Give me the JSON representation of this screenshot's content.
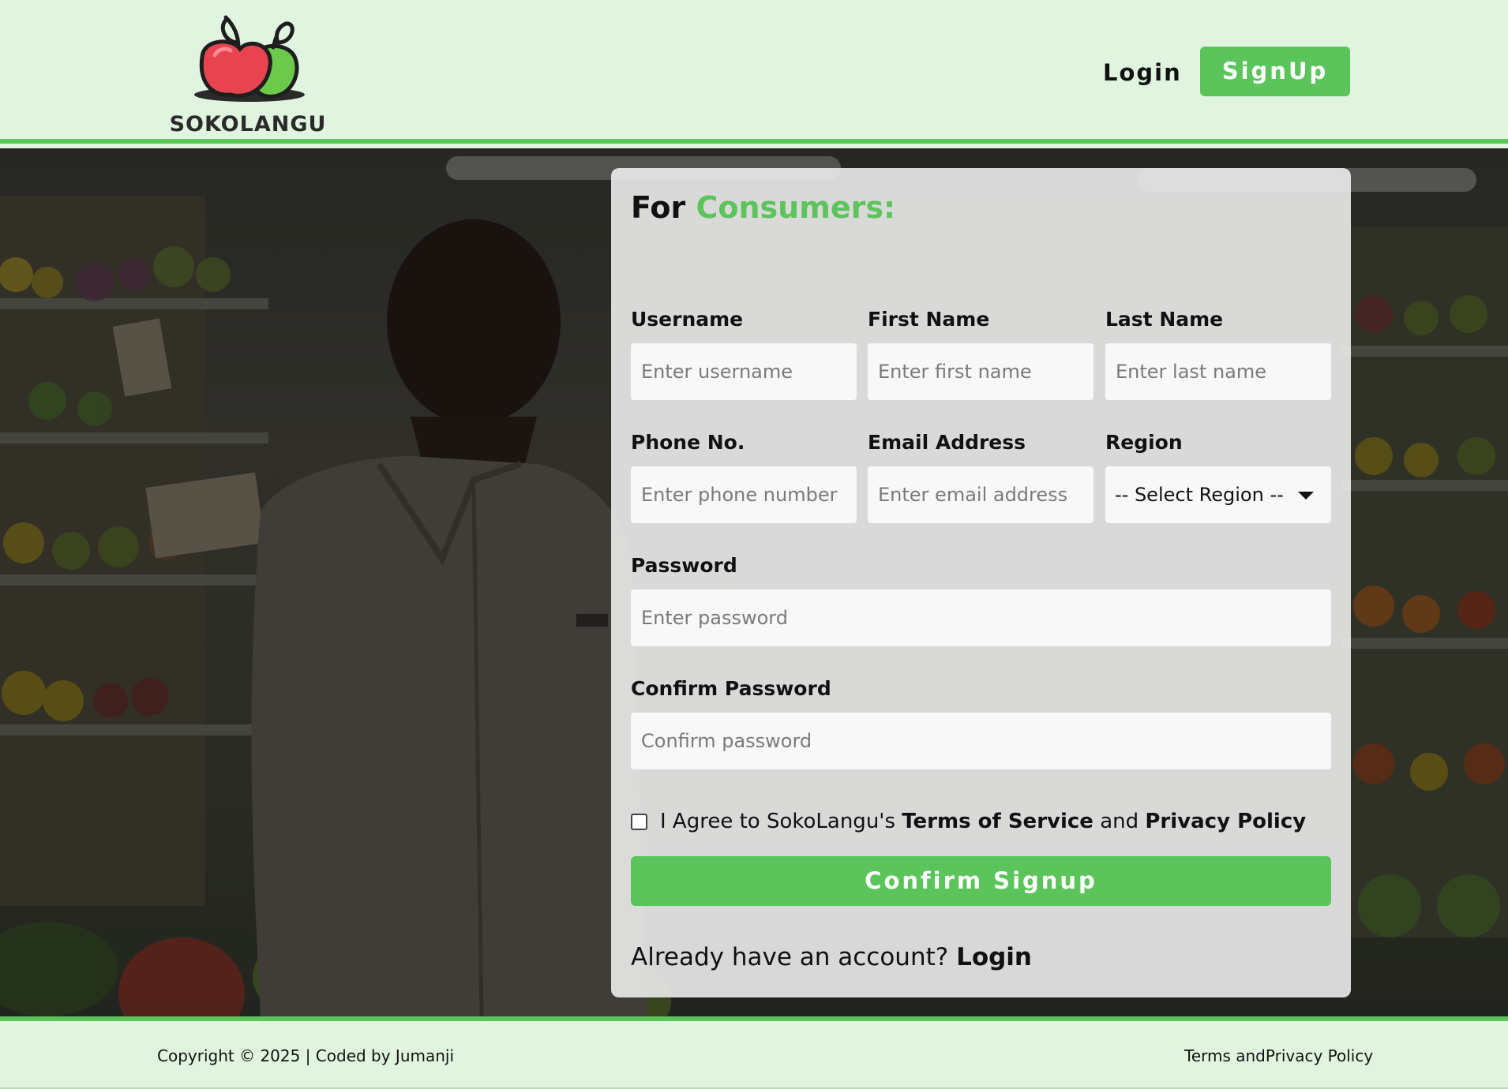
{
  "header": {
    "logo_text": "SOKOLANGU",
    "nav_login": "Login",
    "nav_signup": "SignUp"
  },
  "form": {
    "title_prefix": "For",
    "title_accent": "Consumers:",
    "username": {
      "label": "Username",
      "placeholder": "Enter username"
    },
    "first_name": {
      "label": "First Name",
      "placeholder": "Enter first name"
    },
    "last_name": {
      "label": "Last Name",
      "placeholder": "Enter last name"
    },
    "phone": {
      "label": "Phone No.",
      "placeholder": "Enter phone number"
    },
    "email": {
      "label": "Email Address",
      "placeholder": "Enter email address"
    },
    "region": {
      "label": "Region",
      "selected": "-- Select Region --"
    },
    "password": {
      "label": "Password",
      "placeholder": "Enter password"
    },
    "confirm_password": {
      "label": "Confirm Password",
      "placeholder": "Confirm password"
    },
    "agree_text_1": "I Agree to SokoLangu's",
    "agree_terms": "Terms of Service",
    "agree_and": "and",
    "agree_privacy": "Privacy Policy",
    "confirm_button": "Confirm Signup",
    "already_text": "Already have an account?",
    "already_login": "Login"
  },
  "footer": {
    "copyright": "Copyright © 2025 | Coded by Jumanji",
    "terms_link": "Terms andPrivacy Policy"
  },
  "colors": {
    "accent": "#5bc45b",
    "header_bg": "#e0f4e0"
  }
}
